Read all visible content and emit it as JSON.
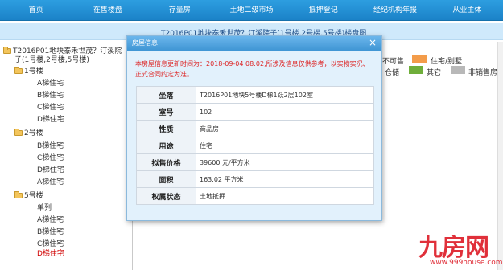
{
  "nav": [
    "首页",
    "在售楼盘",
    "存量房",
    "土地二级市场",
    "抵押登记",
    "经纪机构年报",
    "从业主体"
  ],
  "page_title": "T2016P01地块泰禾世茂？汀溪院子(1号楼,2号楼,5号楼)楼盘图",
  "tree": {
    "root_line1": "T2016P01地块泰禾世茂？汀溪院",
    "root_line2": "子(1号楼,2号楼,5号楼)",
    "b1": "1号楼",
    "b1_items": [
      "A梯住宅",
      "B梯住宅",
      "C梯住宅",
      "D梯住宅"
    ],
    "b2": "2号楼",
    "b2_items": [
      "B梯住宅",
      "C梯住宅",
      "D梯住宅",
      "A梯住宅"
    ],
    "b5": "5号楼",
    "b5_items": [
      "单列",
      "A梯住宅",
      "B梯住宅",
      "C梯住宅",
      "D梯住宅"
    ]
  },
  "legend": {
    "a": "不可售",
    "b": "住宅/别墅",
    "c": "仓储",
    "d": "其它",
    "e": "非销售房",
    "colors": {
      "villa": "#f39c4a",
      "other": "#6fae3a",
      "nonsale": "#b8b8b8"
    }
  },
  "dialog": {
    "title": "房屋信息",
    "notice": "本房屋信息更新时间为：2018-09-04 08:02,所涉及信息仅供参考，以实物实况、正式合同约定为准。",
    "rows": [
      {
        "k": "坐落",
        "v": "T2016P01地块5号楼D梯1跃2层102室"
      },
      {
        "k": "室号",
        "v": "102"
      },
      {
        "k": "性质",
        "v": "商品房"
      },
      {
        "k": "用途",
        "v": "住宅"
      },
      {
        "k": "拟售价格",
        "v": "39600 元/平方米"
      },
      {
        "k": "面积",
        "v": "163.02 平方米"
      },
      {
        "k": "权属状态",
        "v": "土地抵押"
      }
    ]
  },
  "watermark": {
    "logo": "九房网",
    "url": "www.999house.com"
  }
}
